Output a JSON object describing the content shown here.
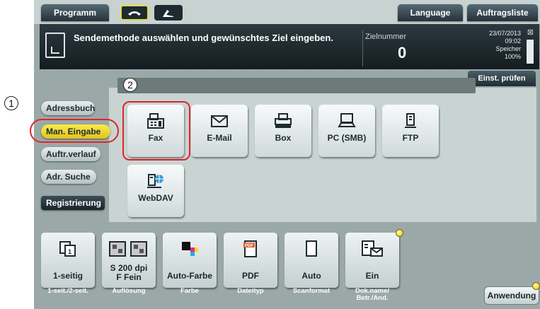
{
  "top_bar": {
    "program": "Programm",
    "language": "Language",
    "job_list": "Auftragsliste"
  },
  "header": {
    "message": "Sendemethode auswählen und gewünschtes Ziel eingeben.",
    "target_number_label": "Zielnummer",
    "target_number_value": "0",
    "date": "23/07/2013",
    "time": "09:02",
    "memory_label": "Speicher",
    "memory_value": "100%",
    "memory_level": 1.0,
    "check_button": "Einst. prüfen"
  },
  "nav": [
    "Adressbuch",
    "Man. Eingabe",
    "Auftr.verlauf",
    "Adr. Suche",
    "Registrierung"
  ],
  "destinations": [
    {
      "label": "Fax",
      "icon": "fax-icon"
    },
    {
      "label": "E-Mail",
      "icon": "mail-icon"
    },
    {
      "label": "Box",
      "icon": "box-icon"
    },
    {
      "label": "PC (SMB)",
      "icon": "pc-icon"
    },
    {
      "label": "FTP",
      "icon": "ftp-icon"
    },
    {
      "label": "WebDAV",
      "icon": "webdav-icon"
    }
  ],
  "settings": [
    {
      "value": "1-seitig",
      "caption": "1-seit./2-seit.",
      "icon": "simplex-icon"
    },
    {
      "value": "S 200 dpi\nF Fein",
      "caption": "Auflösung",
      "icon": "resolution-icon"
    },
    {
      "value": "Auto-Farbe",
      "caption": "Farbe",
      "icon": "color-icon"
    },
    {
      "value": "PDF",
      "caption": "Dateityp",
      "icon": "pdf-icon"
    },
    {
      "value": "Auto",
      "caption": "Scanformat",
      "icon": "page-icon"
    },
    {
      "value": "Ein",
      "caption": "Dok.name/\nBetr./And.",
      "icon": "docname-icon"
    }
  ],
  "start_button": "Anwendung",
  "callouts": [
    "1",
    "2"
  ],
  "colors": {
    "highlight": "#e0242b",
    "selected": "#f2de3a"
  }
}
